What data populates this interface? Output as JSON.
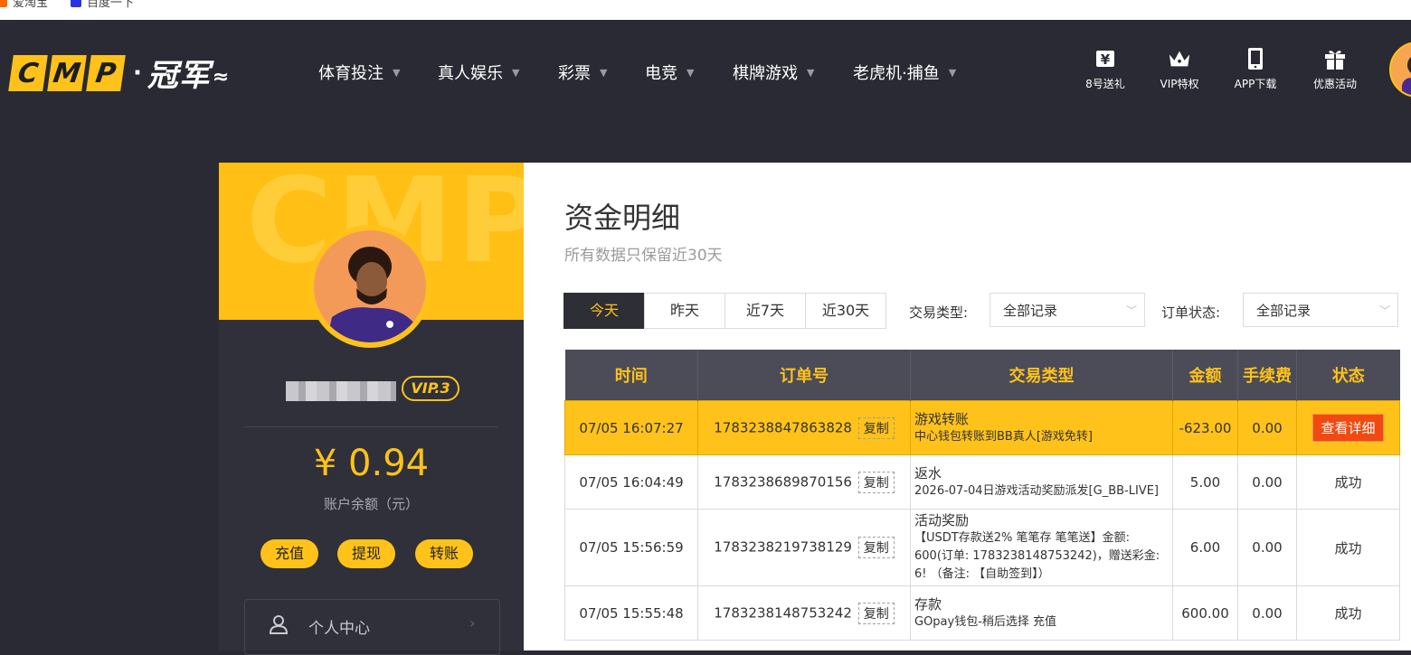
{
  "bookmarks": [
    {
      "label": "爱淘宝",
      "color": "#ff6600"
    },
    {
      "label": "百度一下",
      "color": "#2932e1"
    }
  ],
  "logo": {
    "letters": [
      "C",
      "M",
      "P"
    ],
    "dot": "·",
    "cn": "冠军",
    "tail": "≈"
  },
  "nav": [
    {
      "label": "体育投注"
    },
    {
      "label": "真人娱乐"
    },
    {
      "label": "彩票"
    },
    {
      "label": "电竞"
    },
    {
      "label": "棋牌游戏"
    },
    {
      "label": "老虎机·捕鱼"
    }
  ],
  "quick_links": [
    {
      "label": "8号送礼",
      "icon": "yuan-icon"
    },
    {
      "label": "VIP特权",
      "icon": "crown-icon"
    },
    {
      "label": "APP下载",
      "icon": "phone-icon"
    },
    {
      "label": "优惠活动",
      "icon": "gift-icon"
    }
  ],
  "sidebar": {
    "watermark": "CMP",
    "vip": "VIP.3",
    "balance": "¥ 0.94",
    "balance_label": "账户余额（元）",
    "buttons": [
      "充值",
      "提现",
      "转账"
    ],
    "menu": [
      {
        "label": "个人中心",
        "icon": "user-icon"
      }
    ]
  },
  "main": {
    "title": "资金明细",
    "subtitle": "所有数据只保留近30天",
    "date_tabs": [
      "今天",
      "昨天",
      "近7天",
      "近30天"
    ],
    "filters": {
      "type_label": "交易类型:",
      "type_value": "全部记录",
      "status_label": "订单状态:",
      "status_value": "全部记录"
    },
    "table": {
      "headers": [
        "时间",
        "订单号",
        "交易类型",
        "金额",
        "手续费",
        "状态"
      ],
      "copy_label": "复制",
      "rows": [
        {
          "time": "07/05 16:07:27",
          "order": "1783238847863828",
          "type": "游戏转账",
          "desc": "中心钱包转账到BB真人[游戏免转]",
          "amount": "-623.00",
          "fee": "0.00",
          "status": "查看详细",
          "highlight": true
        },
        {
          "time": "07/05 16:04:49",
          "order": "1783238689870156",
          "type": "返水",
          "desc": "2026-07-04日游戏活动奖励派发[G_BB-LIVE]",
          "amount": "5.00",
          "fee": "0.00",
          "status": "成功",
          "highlight": false
        },
        {
          "time": "07/05 15:56:59",
          "order": "1783238219738129",
          "type": "活动奖励",
          "desc": "【USDT存款送2% 笔笔存 笔笔送】金额: 600(订单: 1783238148753242)，赠送彩金: 6! （备注: 【自助签到】）",
          "amount": "6.00",
          "fee": "0.00",
          "status": "成功",
          "highlight": false
        },
        {
          "time": "07/05 15:55:48",
          "order": "1783238148753242",
          "type": "存款",
          "desc": "GOpay钱包-稍后选择 充值",
          "amount": "600.00",
          "fee": "0.00",
          "status": "成功",
          "highlight": false
        }
      ]
    }
  }
}
